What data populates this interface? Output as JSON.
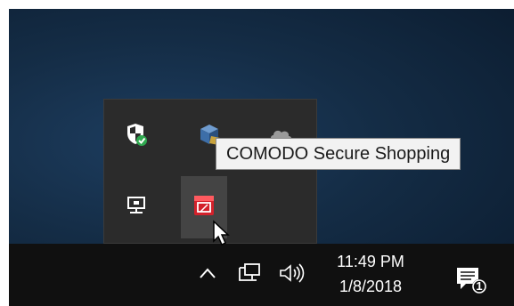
{
  "tray_popup": {
    "icons": [
      {
        "name": "windows-defender-shield-icon"
      },
      {
        "name": "virtualbox-icon"
      },
      {
        "name": "onedrive-cloud-icon"
      },
      {
        "name": "network-monitor-icon"
      },
      {
        "name": "comodo-secure-shopping-icon"
      }
    ]
  },
  "tooltip": {
    "text": "COMODO Secure Shopping"
  },
  "taskbar": {
    "show_hidden_icon": "chevron-up-icon",
    "network_icon": "network-icon",
    "volume_icon": "volume-icon",
    "clock": {
      "time": "11:49 PM",
      "date": "1/8/2018"
    },
    "action_center": {
      "icon": "notification-icon",
      "badge": "1"
    }
  },
  "colors": {
    "taskbar_bg": "#101010",
    "popup_bg": "#2b2b2b",
    "defender_check": "#2fa84f",
    "comodo_red": "#d3212b",
    "tooltip_bg": "#f2f2f2"
  }
}
